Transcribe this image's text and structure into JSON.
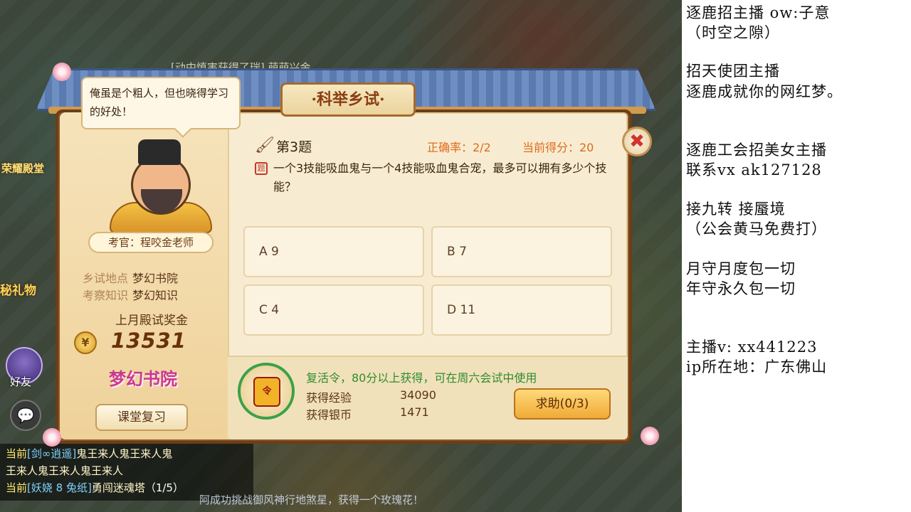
{
  "game": {
    "top_banner": "[动中慎害获得了瑞] 萌萌兴金...",
    "side": {
      "glory_label": "荣耀殿堂",
      "gift_label": "秘礼物",
      "friend_label": "好友",
      "chat_icon": "speech-bubble-icon"
    },
    "chat_log": [
      {
        "channel": "当前",
        "name": "[剑∞逍遥]",
        "message": "鬼王来人鬼王来人鬼"
      },
      {
        "channel": "",
        "name": "",
        "message": "王来人鬼王来人鬼王来人"
      },
      {
        "channel": "当前",
        "name": "[妖娆 8 兔纸]",
        "message": "勇闯迷魂塔",
        "progress": "（1/5）"
      }
    ],
    "bottom_ticker": "阿成功挑战御风神行地煞星，获得一个玫瑰花！"
  },
  "dialog": {
    "title": "·科举乡试·",
    "close_icon": "close-x-icon",
    "speech": "俺虽是个粗人，但也晓得学习的好处！",
    "examiner_tag": "考官：程咬金老师",
    "location_key": "乡试地点",
    "location_value": "梦幻书院",
    "knowledge_key": "考察知识",
    "knowledge_value": "梦幻知识",
    "bonus_label": "上月殿试奖金",
    "bonus_value": "13531",
    "school_logo": "梦幻书院",
    "review_button": "课堂复习",
    "question": {
      "number": "第3题",
      "accuracy": "正确率：2/2",
      "score": "当前得分：20",
      "text": "一个3技能吸血鬼与一个4技能吸血鬼合宠，最多可以拥有多少个技能？",
      "options": {
        "a": "A 9",
        "b": "B 7",
        "c": "C 4",
        "d": "D 11"
      }
    },
    "reward": {
      "revive_text": "复活令，80分以上获得，可在周六会试中使用",
      "exp_key": "获得经验",
      "exp_value": "34090",
      "silver_key": "获得银币",
      "silver_value": "1471"
    },
    "help_button": "求助(0/3)"
  },
  "stream_overlay": {
    "lines": [
      "逐鹿招主播 ow:子意",
      "（时空之隙）",
      "招天使团主播",
      "逐鹿成就你的网红梦。",
      "逐鹿工会招美女主播",
      "联系vx   ak127128",
      "接九转 接蜃境",
      "（公会黄马免费打）",
      "月守月度包一切",
      "年守永久包一切",
      "主播v: xx441223",
      "ip所在地：广东佛山"
    ]
  }
}
